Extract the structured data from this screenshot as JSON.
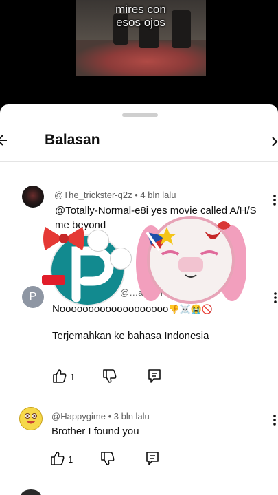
{
  "video": {
    "caption_line1": "mires con",
    "caption_line2": "esos ojos"
  },
  "header": {
    "title": "Balasan"
  },
  "comments": [
    {
      "author": "@The_trickster-q2z",
      "time": "4 bln lalu",
      "text_line1": "@Totally-Normal-e8i yes movie called A/H/S",
      "text_line2": "me beyond"
    },
    {
      "author_initial": "P",
      "author": "@…ani",
      "time": "4 b…",
      "text": "Nooooooooooooooooooo",
      "emoji": "👎☠️😭🚫",
      "translate": "Terjemahkan ke bahasa Indonesia",
      "likes": "1"
    },
    {
      "author": "@Happygime",
      "time": "3 bln lalu",
      "text": "Brother I found you",
      "likes": "1"
    }
  ],
  "colors": {
    "avatar_p": "#8e96a3",
    "teal_sticker": "#128a8f",
    "pink_sticker": "#f29fbd"
  }
}
